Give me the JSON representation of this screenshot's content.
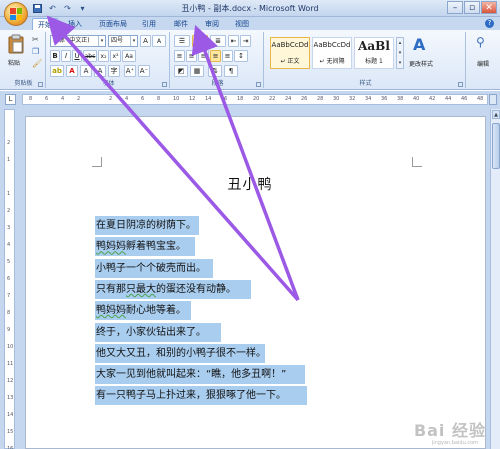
{
  "window": {
    "title": "丑小鸭 - 副本.docx - Microsoft Word",
    "controls": [
      "–",
      "▫",
      "✕"
    ]
  },
  "quick_access": [
    "save-icon",
    "undo-icon",
    "redo-icon",
    "customize-icon"
  ],
  "tabs": [
    {
      "label": "开始",
      "active": true
    },
    {
      "label": "插入",
      "active": false
    },
    {
      "label": "页面布局",
      "active": false
    },
    {
      "label": "引用",
      "active": false
    },
    {
      "label": "邮件",
      "active": false
    },
    {
      "label": "审阅",
      "active": false
    },
    {
      "label": "视图",
      "active": false
    }
  ],
  "ribbon": {
    "clipboard": {
      "paste_label": "粘贴",
      "group_label": "剪贴板"
    },
    "font": {
      "font_name": "宋体 (中文正)",
      "font_size": "四号",
      "group_label": "字体"
    },
    "paragraph": {
      "group_label": "段落"
    },
    "styles": {
      "group_label": "样式",
      "items": [
        {
          "sample": "AaBbCcDd",
          "name": "↵ 正文",
          "selected": true
        },
        {
          "sample": "AaBbCcDd",
          "name": "↵ 无间隔",
          "selected": false
        },
        {
          "sample": "AaBl",
          "name": "标题 1",
          "selected": false
        }
      ],
      "change_styles_label": "更改样式",
      "edit_label": "编辑"
    }
  },
  "ruler": {
    "ticks": [
      "8",
      "6",
      "4",
      "2",
      "",
      "2",
      "4",
      "6",
      "8",
      "10",
      "12",
      "14",
      "16",
      "18",
      "20",
      "22",
      "24",
      "26",
      "28",
      "30",
      "32",
      "34",
      "36",
      "38",
      "40",
      "42",
      "44",
      "46",
      "48"
    ],
    "vticks": [
      "2",
      "1",
      "",
      "1",
      "2",
      "3",
      "4",
      "5",
      "6",
      "7",
      "8",
      "9",
      "10",
      "11",
      "12",
      "13",
      "14",
      "15",
      "16"
    ]
  },
  "document": {
    "title": "丑小鸭",
    "lines": [
      {
        "pre": "",
        "ul": "",
        "post": "在夏日阴凉的树荫下。"
      },
      {
        "pre": "",
        "ul": "鸭妈妈",
        "post": "孵着鸭宝宝。"
      },
      {
        "pre": "",
        "ul": "",
        "post": "小鸭子一个个破壳而出。"
      },
      {
        "pre": "只有那",
        "ul": "只最大",
        "post": "的蛋还没有动静。"
      },
      {
        "pre": "",
        "ul": "鸭妈妈",
        "post": "耐心地等着。"
      },
      {
        "pre": "",
        "ul": "",
        "post": "终于，小家伙钻出来了。"
      },
      {
        "pre": "",
        "ul": "",
        "post": "他又大又丑，和别的小鸭子很不一样。"
      },
      {
        "pre": "",
        "ul": "",
        "post": "大家一见到他就叫起来：“瞧，他多丑啊！”"
      },
      {
        "pre": "",
        "ul": "",
        "post": "有一只鸭子马上扑过来，狠狠啄了他一下。"
      }
    ]
  },
  "watermark": {
    "text": "Bai 经验",
    "sub": "jingyan.baidu.com"
  },
  "colors": {
    "selection": "#a9cdee",
    "annotation": "#9b59e6",
    "ribbon_bg": "#dbe7f7"
  }
}
